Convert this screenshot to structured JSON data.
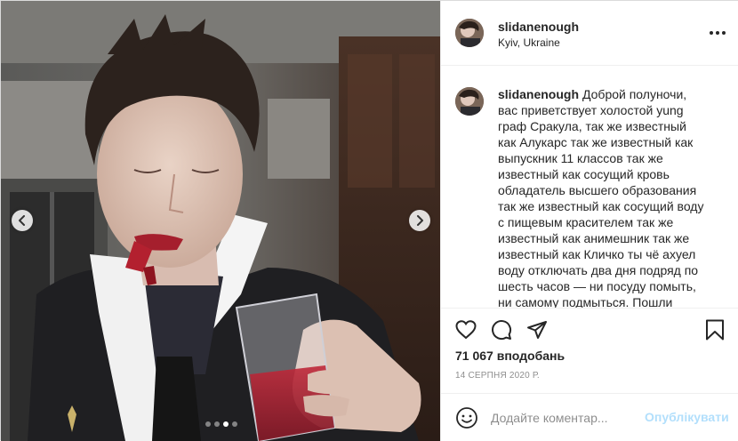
{
  "post": {
    "username": "slidanenough",
    "location": "Kyiv, Ukraine",
    "caption": "Доброй полуночи, вас приветствует холостой yung граф Сракула, так же известный как Алукарс так же известный как выпускник 11 классов так же известный как сосущий кровь обладатель высшего образования так же известный как сосущий воду с пищевым красителем так же известный как анимешник так же известный как Кличко ты чё ахуел воду отключать два дня подряд по шесть часов — ни посуду помыть, ни самому подмыться. Пошли",
    "likes": "71 067 вподобань",
    "date": "14 СЕРПНЯ 2020 Р."
  },
  "carousel": {
    "slide_count": 4,
    "active_slide": 3
  },
  "comment": {
    "placeholder": "Додайте коментар...",
    "publish_label": "Опублікувати"
  },
  "icons": {
    "more": "more-options-icon",
    "prev": "chevron-left-icon",
    "next": "chevron-right-icon",
    "like": "heart-icon",
    "comment": "comment-icon",
    "share": "paper-plane-icon",
    "save": "bookmark-icon",
    "emoji": "smiley-icon"
  },
  "colors": {
    "publish_disabled": "#b2dffc",
    "text": "#262626",
    "muted": "#8e8e8e",
    "border": "#efefef"
  }
}
